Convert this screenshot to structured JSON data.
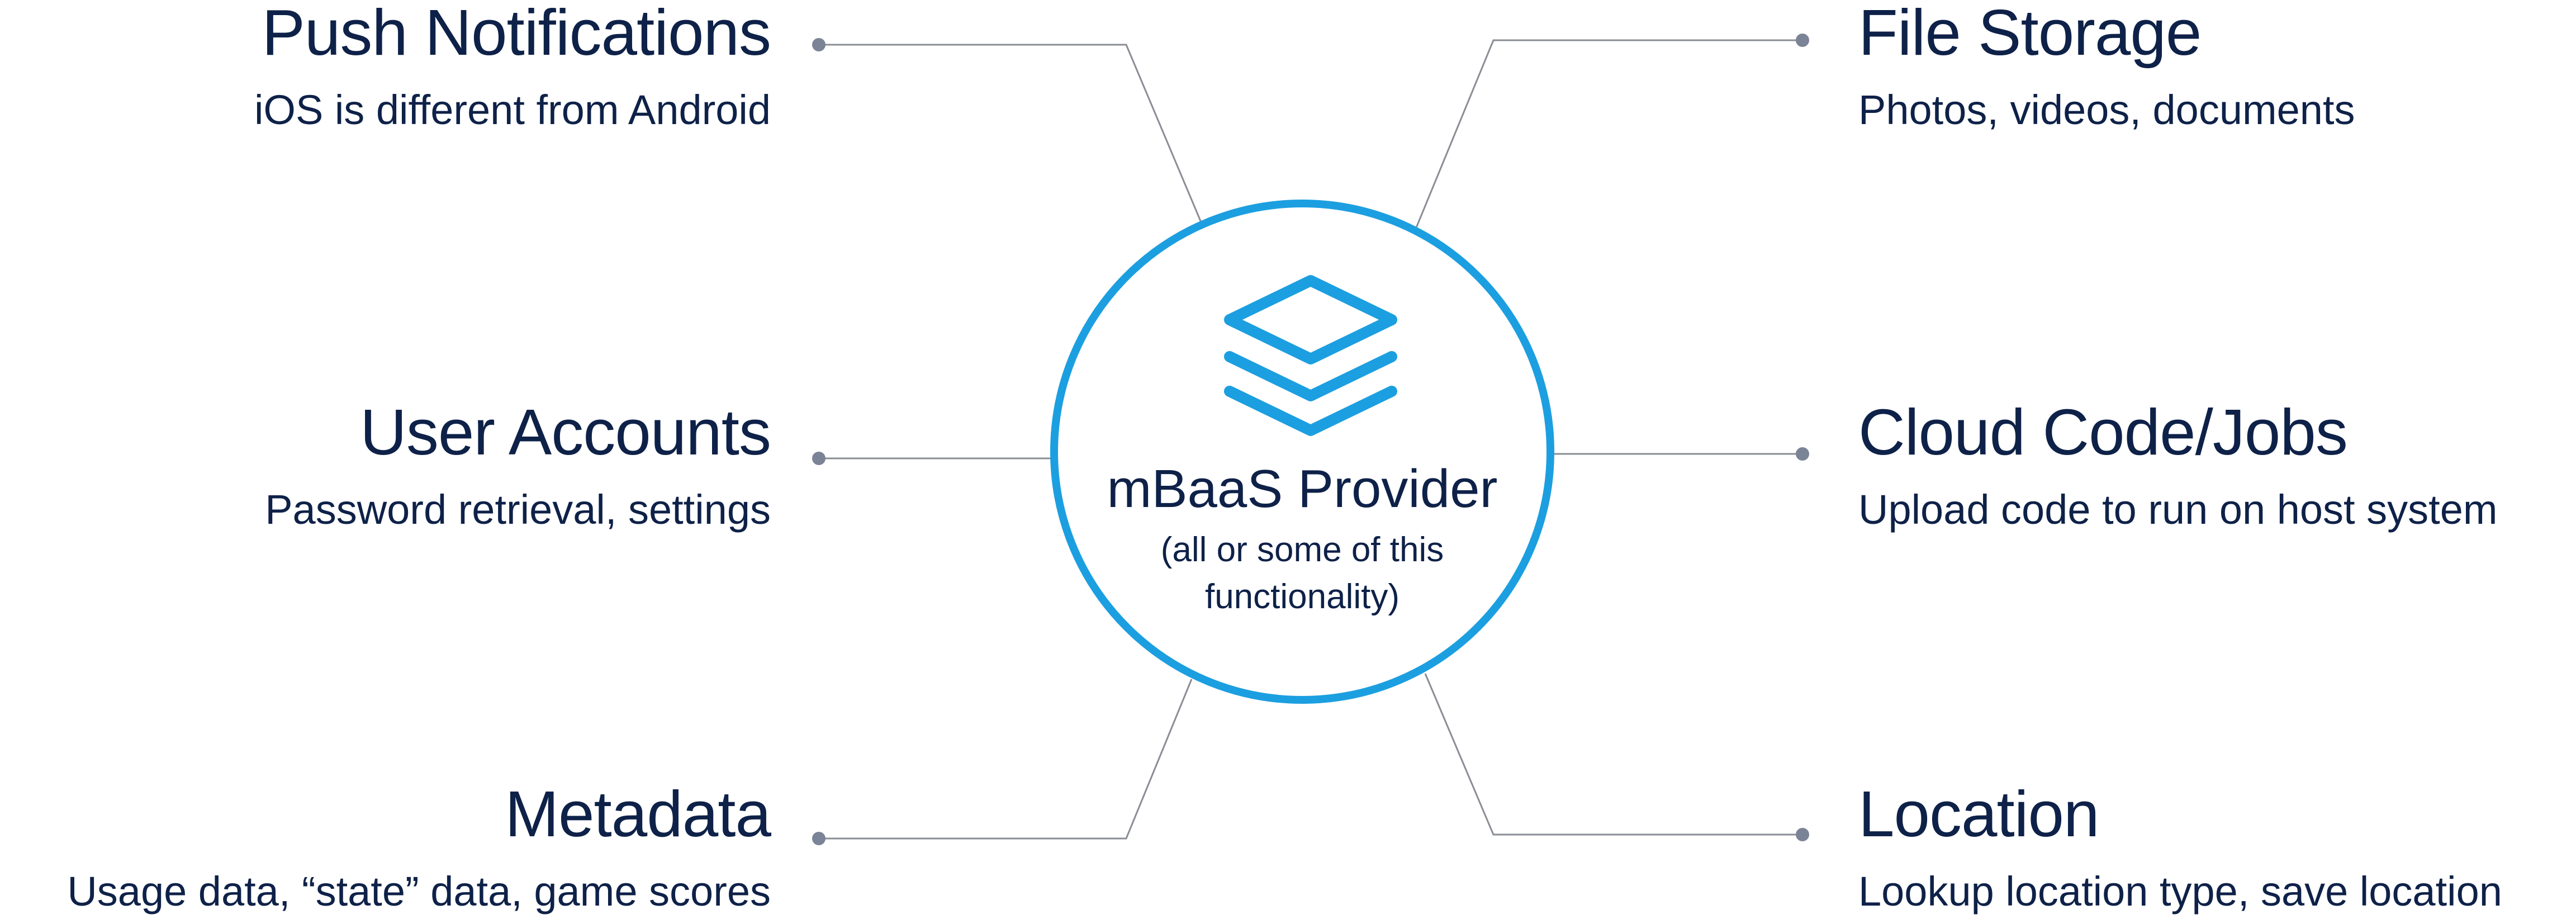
{
  "center": {
    "title": "mBaaS Provider",
    "subtitle": "(all or some of this functionality)",
    "icon": "stacked-layers-icon"
  },
  "colors": {
    "text": "#0e2148",
    "accent": "#1c9fe0",
    "connector": "#8a8d94",
    "dot": "#7b8396"
  },
  "features": {
    "push": {
      "title": "Push Notifications",
      "subtitle": "iOS is different from Android"
    },
    "accounts": {
      "title": "User Accounts",
      "subtitle": "Password retrieval, settings"
    },
    "metadata": {
      "title": "Metadata",
      "subtitle": "Usage data, “state” data, game scores"
    },
    "storage": {
      "title": "File Storage",
      "subtitle": "Photos, videos, documents"
    },
    "cloud": {
      "title": "Cloud Code/Jobs",
      "subtitle": "Upload code to run on host system"
    },
    "location": {
      "title": "Location",
      "subtitle": "Lookup location type, save location"
    }
  }
}
